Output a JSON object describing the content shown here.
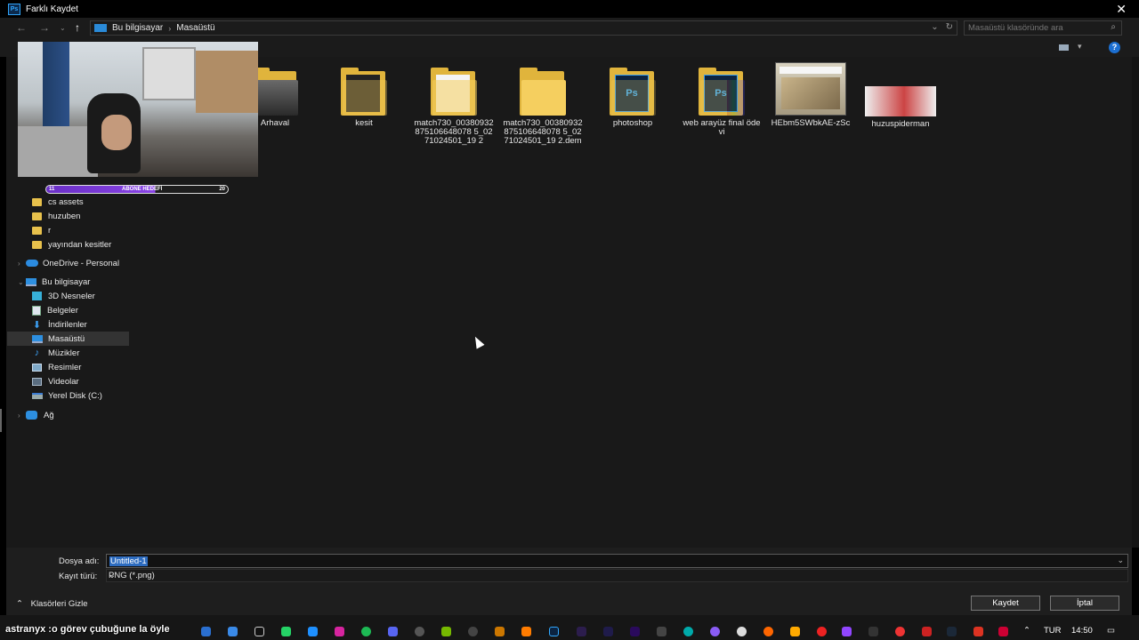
{
  "window": {
    "title": "Farklı Kaydet",
    "app_icon": "Ps"
  },
  "breadcrumb": [
    "Bu bilgisayar",
    "Masaüstü"
  ],
  "search": {
    "placeholder": "Masaüstü klasöründe ara"
  },
  "help_label": "?",
  "sidebar": {
    "items": [
      {
        "label": "cs assets",
        "icon": "folder-icon"
      },
      {
        "label": "huzuben",
        "icon": "folder-icon"
      },
      {
        "label": "r",
        "icon": "folder-icon"
      },
      {
        "label": "yayından kesitler",
        "icon": "folder-icon"
      },
      {
        "label": "OneDrive - Personal",
        "icon": "cloud-icon"
      },
      {
        "label": "Bu bilgisayar",
        "icon": "computer-icon"
      },
      {
        "label": "3D Nesneler",
        "icon": "cube-icon"
      },
      {
        "label": "Belgeler",
        "icon": "document-icon"
      },
      {
        "label": "İndirilenler",
        "icon": "download-icon"
      },
      {
        "label": "Masaüstü",
        "icon": "desktop-icon",
        "selected": true
      },
      {
        "label": "Müzikler",
        "icon": "music-icon"
      },
      {
        "label": "Resimler",
        "icon": "pictures-icon"
      },
      {
        "label": "Videolar",
        "icon": "videos-icon"
      },
      {
        "label": "Yerel Disk (C:)",
        "icon": "disk-icon"
      },
      {
        "label": "Ağ",
        "icon": "network-icon"
      }
    ]
  },
  "files": [
    {
      "name": "Arhaval",
      "type": "folder"
    },
    {
      "name": "kesit",
      "type": "folder"
    },
    {
      "name": "match730_00380932875106648078 5_0271024501_19 2",
      "type": "file"
    },
    {
      "name": "match730_00380932875106648078 5_0271024501_19 2.dem",
      "type": "folder"
    },
    {
      "name": "photoshop",
      "type": "psd-folder"
    },
    {
      "name": "web arayüz final ödevi",
      "type": "psd-folder"
    },
    {
      "name": "HEbm5SWbkAE-zSc",
      "type": "image"
    },
    {
      "name": "huzuspiderman",
      "type": "image"
    }
  ],
  "overlay": {
    "sub_left": "11",
    "sub_mid": "ABONE HEDEFİ",
    "sub_right": "20"
  },
  "form": {
    "filename_label": "Dosya adı:",
    "filename_value": "Untitled-1",
    "filetype_label": "Kayıt türü:",
    "filetype_value": "PNG (*.png)"
  },
  "footer": {
    "hide_folders": "Klasörleri Gizle",
    "save_button": "Kaydet",
    "cancel_button": "İptal"
  },
  "taskbar": {
    "ticker": "astranyx :o görev çubuğune la öyle",
    "lang": "TUR",
    "time": "14:50"
  }
}
